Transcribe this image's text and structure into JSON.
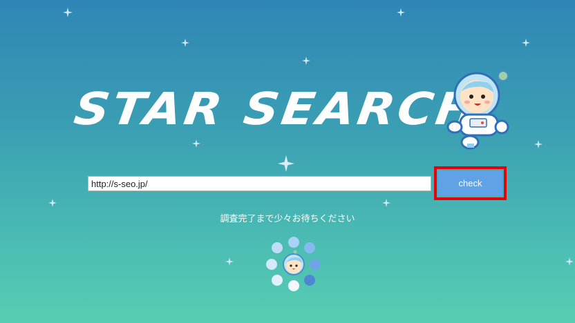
{
  "logo": {
    "text": "STAR SEARCH"
  },
  "search": {
    "value": "http://s-seo.jp/",
    "button_label": "check"
  },
  "status": {
    "message": "調査完了まで少々お待ちください"
  },
  "colors": {
    "background_top": "#2f86b6",
    "background_bottom": "#58cdb3",
    "button": "#5fa3e6",
    "highlight": "#e8000b"
  },
  "icons": [
    "sparkle-star-icon",
    "astronaut-mascot-icon",
    "loading-spinner-icon"
  ]
}
